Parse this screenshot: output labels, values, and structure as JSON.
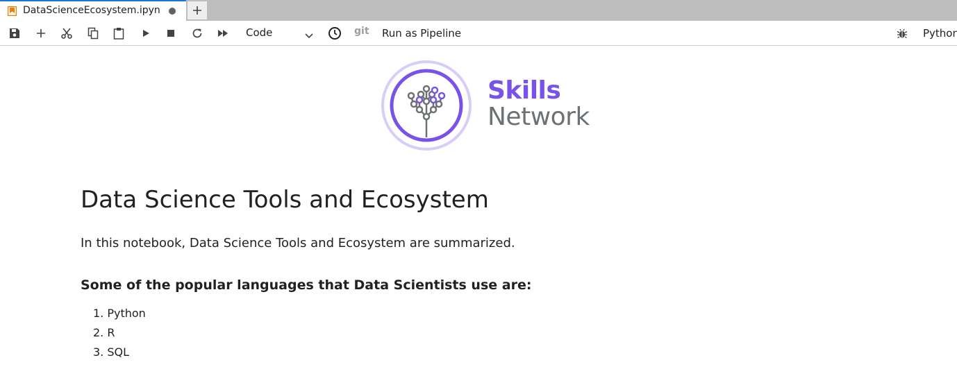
{
  "tabs": [
    {
      "title": "DataScienceEcosystem.ipyn",
      "icon": "notebook-icon",
      "dirty": true
    }
  ],
  "toolbar": {
    "cell_type": "Code",
    "git_label": "git",
    "pipeline_label": "Run as Pipeline",
    "kernel_name": "Python"
  },
  "logo": {
    "line1": "Skills",
    "line2": "Network",
    "colors": {
      "purple": "#7952e8",
      "gray": "#6e7173",
      "ring": "#d9cdf7"
    }
  },
  "notebook": {
    "heading": "Data Science Tools and Ecosystem",
    "intro": "In this notebook, Data Science Tools and Ecosystem are summarized.",
    "subheading": "Some of the popular languages that Data Scientists use are:",
    "languages": [
      "1. Python",
      "2. R",
      "3. SQL"
    ]
  },
  "colors": {
    "tab_accent": "#1976d2",
    "tabbar_bg": "#bdbdbd",
    "notebook_icon": "#f57c00"
  }
}
